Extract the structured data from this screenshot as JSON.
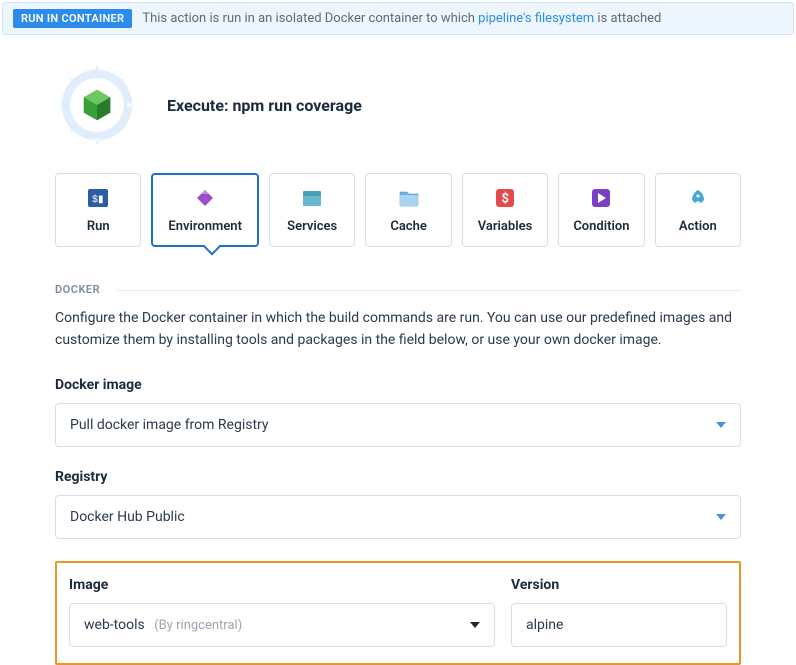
{
  "banner": {
    "badge": "RUN IN CONTAINER",
    "text_before": "This action is run in an isolated Docker container to which ",
    "link": "pipeline's filesystem",
    "text_after": " is attached"
  },
  "header": {
    "title": "Execute: npm run coverage"
  },
  "tabs": [
    {
      "label": "Run",
      "icon": "terminal-icon"
    },
    {
      "label": "Environment",
      "icon": "diamond-icon"
    },
    {
      "label": "Services",
      "icon": "box-icon"
    },
    {
      "label": "Cache",
      "icon": "folder-icon"
    },
    {
      "label": "Variables",
      "icon": "dollar-icon"
    },
    {
      "label": "Condition",
      "icon": "play-icon"
    },
    {
      "label": "Action",
      "icon": "rocket-icon"
    }
  ],
  "section": {
    "docker_label": "DOCKER",
    "description": "Configure the Docker container in which the build commands are run. You can use our predefined images and customize them by installing tools and packages in the field below, or use your own docker image."
  },
  "fields": {
    "docker_image": {
      "label": "Docker image",
      "value": "Pull docker image from Registry"
    },
    "registry": {
      "label": "Registry",
      "value": "Docker Hub Public"
    },
    "image": {
      "label": "Image",
      "value": "web-tools",
      "by": "(By ringcentral)"
    },
    "version": {
      "label": "Version",
      "value": "alpine"
    }
  }
}
